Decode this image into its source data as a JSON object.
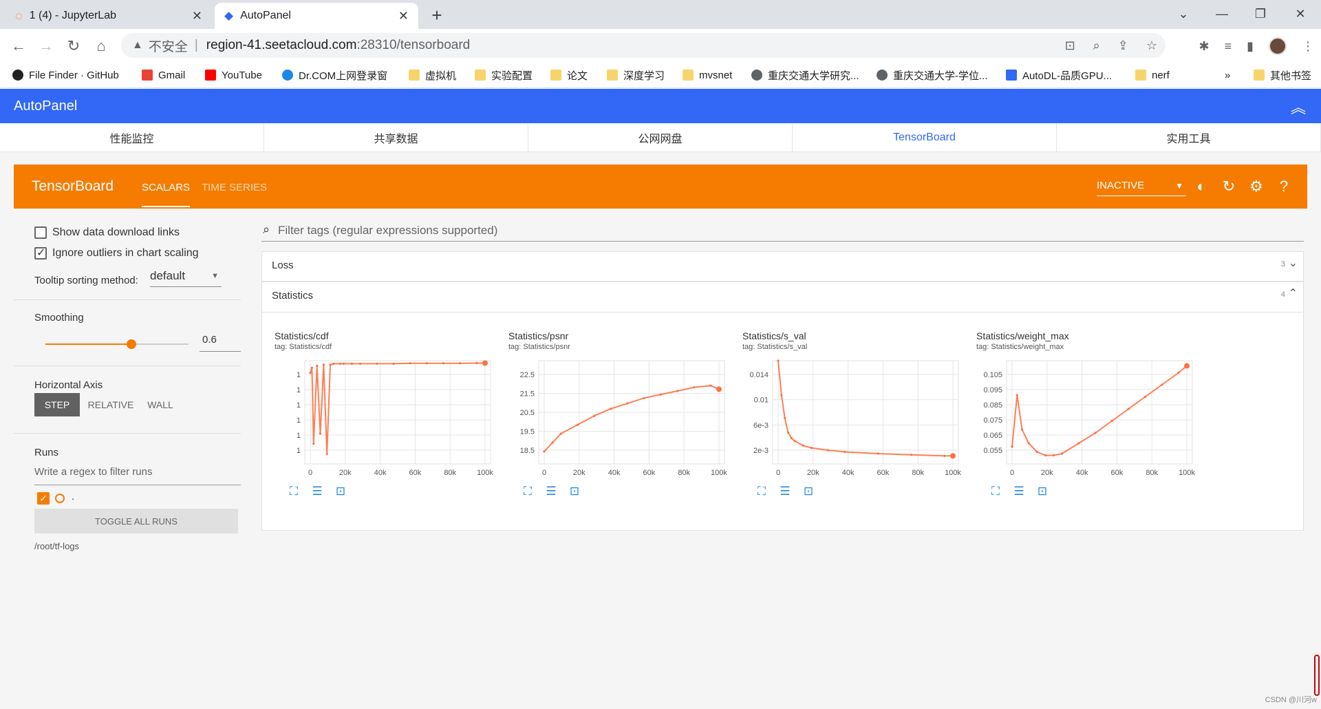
{
  "browser": {
    "tabs": [
      {
        "title": "1 (4) - JupyterLab",
        "active": false
      },
      {
        "title": "AutoPanel",
        "active": true
      }
    ],
    "address": {
      "insecure_label": "不安全",
      "host": "region-41.seetacloud.com",
      "path": ":28310/tensorboard"
    },
    "bookmarks": [
      {
        "label": "File Finder · GitHub",
        "icon": "github-icon"
      },
      {
        "label": "Gmail",
        "icon": "gmail-icon"
      },
      {
        "label": "YouTube",
        "icon": "youtube-icon"
      },
      {
        "label": "Dr.COM上网登录窗",
        "icon": "drcom-icon"
      },
      {
        "label": "虚拟机",
        "icon": "folder-icon"
      },
      {
        "label": "实验配置",
        "icon": "folder-icon"
      },
      {
        "label": "论文",
        "icon": "folder-icon"
      },
      {
        "label": "深度学习",
        "icon": "folder-icon"
      },
      {
        "label": "mvsnet",
        "icon": "folder-icon"
      },
      {
        "label": "重庆交通大学研究...",
        "icon": "globe-icon"
      },
      {
        "label": "重庆交通大学-学位...",
        "icon": "globe-icon"
      },
      {
        "label": "AutoDL-品质GPU...",
        "icon": "autodl-icon"
      },
      {
        "label": "nerf",
        "icon": "folder-icon"
      }
    ],
    "bookmarks_overflow": "»",
    "other_bookmarks": "其他书签"
  },
  "autopanel": {
    "title": "AutoPanel",
    "nav": [
      "性能监控",
      "共享数据",
      "公网网盘",
      "TensorBoard",
      "实用工具"
    ],
    "active_nav": "TensorBoard"
  },
  "tensorboard": {
    "title": "TensorBoard",
    "tabs": [
      "SCALARS",
      "TIME SERIES"
    ],
    "status": "INACTIVE",
    "sidebar": {
      "show_download_links": "Show data download links",
      "ignore_outliers": "Ignore outliers in chart scaling",
      "tooltip_label": "Tooltip sorting method:",
      "tooltip_value": "default",
      "smoothing_label": "Smoothing",
      "smoothing_value": "0.6",
      "smoothing_fraction": 0.6,
      "horizontal_axis_label": "Horizontal Axis",
      "axis_options": [
        "STEP",
        "RELATIVE",
        "WALL"
      ],
      "axis_selected": "STEP",
      "runs_label": "Runs",
      "runs_filter_placeholder": "Write a regex to filter runs",
      "run_name": ".",
      "toggle_all": "TOGGLE ALL RUNS",
      "log_path": "/root/tf-logs"
    },
    "filter_placeholder": "Filter tags (regular expressions supported)",
    "groups": [
      {
        "name": "Loss",
        "count": "3",
        "expanded": false
      },
      {
        "name": "Statistics",
        "count": "4",
        "expanded": true
      }
    ]
  },
  "chart_data": [
    {
      "type": "line",
      "title": "Statistics/cdf",
      "tag": "tag: Statistics/cdf",
      "x_ticks": [
        "0",
        "20k",
        "40k",
        "60k",
        "80k",
        "100k"
      ],
      "y_ticks": [
        "1",
        "1",
        "1",
        "1",
        "1",
        "1"
      ],
      "xlim": [
        0,
        105000
      ],
      "grid": true,
      "series": [
        {
          "x": [
            0,
            1000,
            2000,
            4000,
            6000,
            8000,
            10000,
            12000,
            14000,
            18000,
            20000,
            25000,
            30000,
            40000,
            50000,
            60000,
            70000,
            80000,
            90000,
            100000,
            105000
          ],
          "y": [
            0.9,
            0.95,
            0.2,
            0.97,
            0.3,
            0.98,
            0.1,
            0.98,
            0.99,
            0.99,
            0.99,
            0.99,
            0.99,
            0.99,
            0.99,
            0.995,
            0.995,
            0.995,
            0.995,
            0.996,
            0.996
          ]
        }
      ]
    },
    {
      "type": "line",
      "title": "Statistics/psnr",
      "tag": "tag: Statistics/psnr",
      "x_ticks": [
        "0",
        "20k",
        "40k",
        "60k",
        "80k",
        "100k"
      ],
      "y_ticks": [
        "22.5",
        "21.5",
        "20.5",
        "19.5",
        "18.5"
      ],
      "xlim": [
        0,
        105000
      ],
      "ylim": [
        17.6,
        23.4
      ],
      "grid": true,
      "series": [
        {
          "x": [
            0,
            5000,
            10000,
            20000,
            30000,
            40000,
            50000,
            60000,
            70000,
            80000,
            90000,
            100000,
            105000
          ],
          "y": [
            18.3,
            18.8,
            19.3,
            19.8,
            20.3,
            20.7,
            21.0,
            21.3,
            21.5,
            21.7,
            21.9,
            22.0,
            21.8
          ]
        }
      ]
    },
    {
      "type": "line",
      "title": "Statistics/s_val",
      "tag": "tag: Statistics/s_val",
      "x_ticks": [
        "0",
        "20k",
        "40k",
        "60k",
        "80k",
        "100k"
      ],
      "y_ticks": [
        "0.014",
        "0.01",
        "6e-3",
        "2e-3"
      ],
      "xlim": [
        0,
        105000
      ],
      "ylim": [
        0,
        0.018
      ],
      "grid": true,
      "series": [
        {
          "x": [
            0,
            2000,
            4000,
            6000,
            8000,
            10000,
            15000,
            20000,
            30000,
            40000,
            60000,
            80000,
            100000,
            105000
          ],
          "y": [
            0.018,
            0.012,
            0.008,
            0.0055,
            0.0045,
            0.004,
            0.0032,
            0.0028,
            0.0024,
            0.0021,
            0.0018,
            0.0016,
            0.0014,
            0.0014
          ]
        }
      ]
    },
    {
      "type": "line",
      "title": "Statistics/weight_max",
      "tag": "tag: Statistics/weight_max",
      "x_ticks": [
        "0",
        "20k",
        "40k",
        "60k",
        "80k",
        "100k"
      ],
      "y_ticks": [
        "0.105",
        "0.095",
        "0.085",
        "0.075",
        "0.065",
        "0.055"
      ],
      "xlim": [
        0,
        105000
      ],
      "ylim": [
        0.05,
        0.11
      ],
      "grid": true,
      "series": [
        {
          "x": [
            0,
            3000,
            6000,
            10000,
            15000,
            20000,
            25000,
            30000,
            40000,
            50000,
            60000,
            70000,
            80000,
            90000,
            100000,
            105000
          ],
          "y": [
            0.06,
            0.09,
            0.07,
            0.062,
            0.057,
            0.055,
            0.055,
            0.056,
            0.062,
            0.068,
            0.075,
            0.082,
            0.089,
            0.096,
            0.103,
            0.107
          ]
        }
      ]
    }
  ],
  "colors": {
    "accent": "#f57c00",
    "header_blue": "#3268f5",
    "line": "#ff7043"
  },
  "watermark": "CSDN @川河w"
}
